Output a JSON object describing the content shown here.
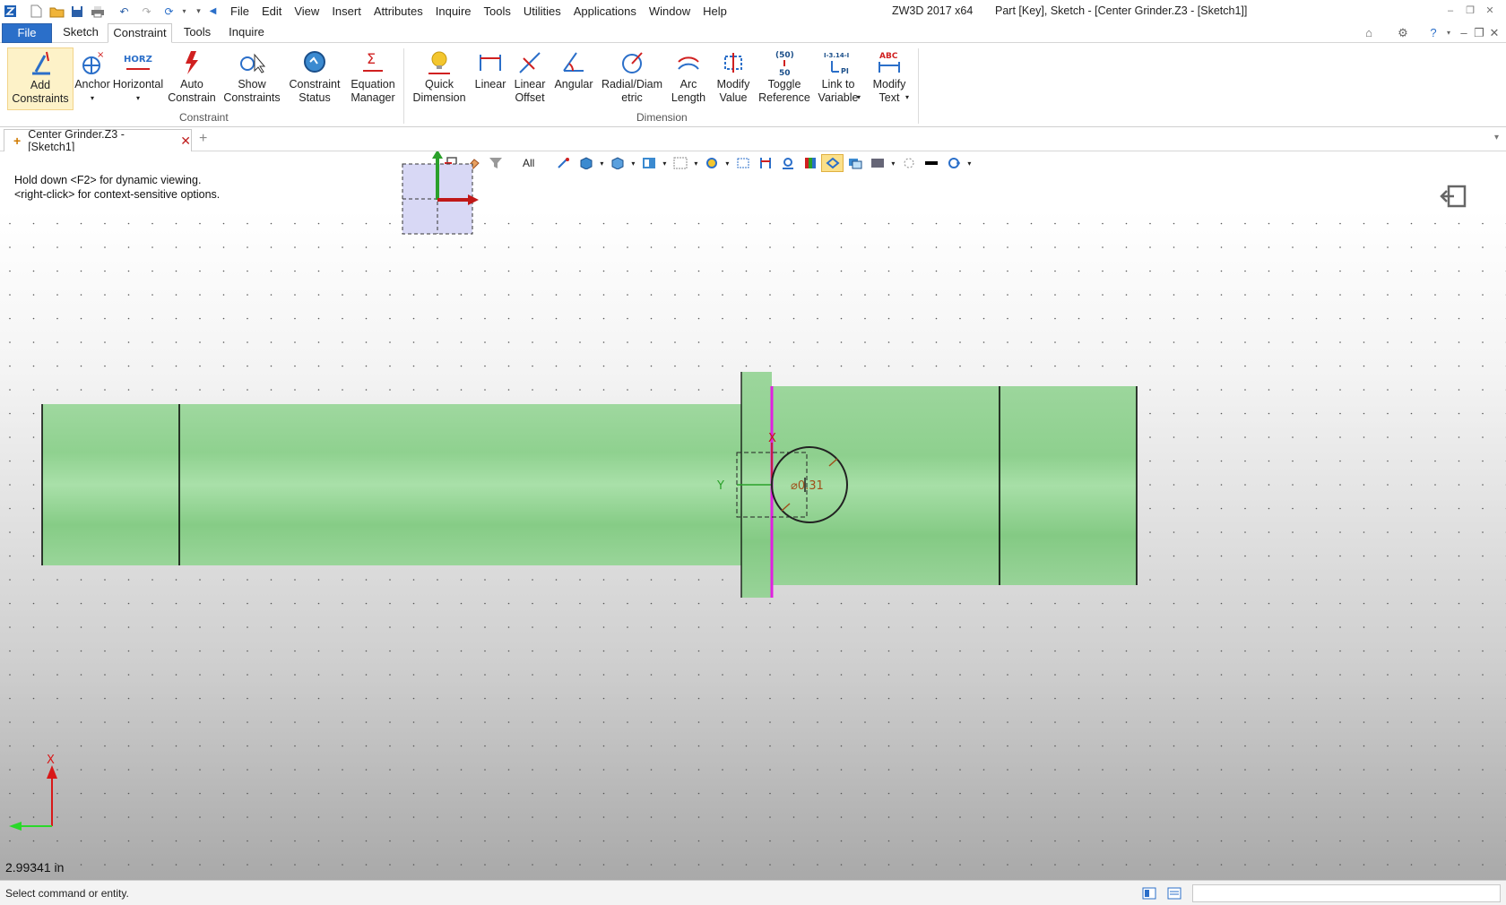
{
  "app": {
    "title": "ZW3D 2017  x64",
    "doc_title": "Part [Key],  Sketch - [Center Grinder.Z3 - [Sketch1]]"
  },
  "menu": [
    "File",
    "Edit",
    "View",
    "Insert",
    "Attributes",
    "Inquire",
    "Tools",
    "Utilities",
    "Applications",
    "Window",
    "Help"
  ],
  "ribbon_tabs": [
    "File",
    "Sketch",
    "Constraint",
    "Tools",
    "Inquire"
  ],
  "ribbon": {
    "constraint_buttons": [
      "Add\nConstraints",
      "Anchor",
      "Horizontal",
      "Auto\nConstrain",
      "Show\nConstraints",
      "Constraint\nStatus",
      "Equation\nManager"
    ],
    "constraint_group": "Constraint",
    "dimension_buttons": [
      "Quick\nDimension",
      "Linear",
      "Linear\nOffset",
      "Angular",
      "Radial/Diam\netric",
      "Arc\nLength",
      "Modify\nValue",
      "Toggle\nReference",
      "Link to\nVariable",
      "Modify\nText"
    ],
    "dimension_group": "Dimension",
    "icon_text": {
      "horz": "HORZ",
      "toggle_top": "(50)",
      "toggle_bottom": "50",
      "link": "I-3.14-I",
      "pi": "PI",
      "abc": "ABC",
      "sigma": "Σ"
    }
  },
  "doc_tab": {
    "label": "Center Grinder.Z3 - [Sketch1]"
  },
  "viewport": {
    "hint_1": "Hold down <F2> for dynamic viewing.",
    "hint_2": "<right-click> for context-sensitive options.",
    "filter": "All",
    "dimension_label": "⌀0.31",
    "axis_x": "X",
    "axis_y": "Y",
    "measure": "2.99341 in"
  },
  "status": {
    "text": "Select command or entity."
  },
  "colors": {
    "accent": "#2b6fc9",
    "shaft_green": "#8fd18f",
    "magenta": "#e020e0"
  }
}
